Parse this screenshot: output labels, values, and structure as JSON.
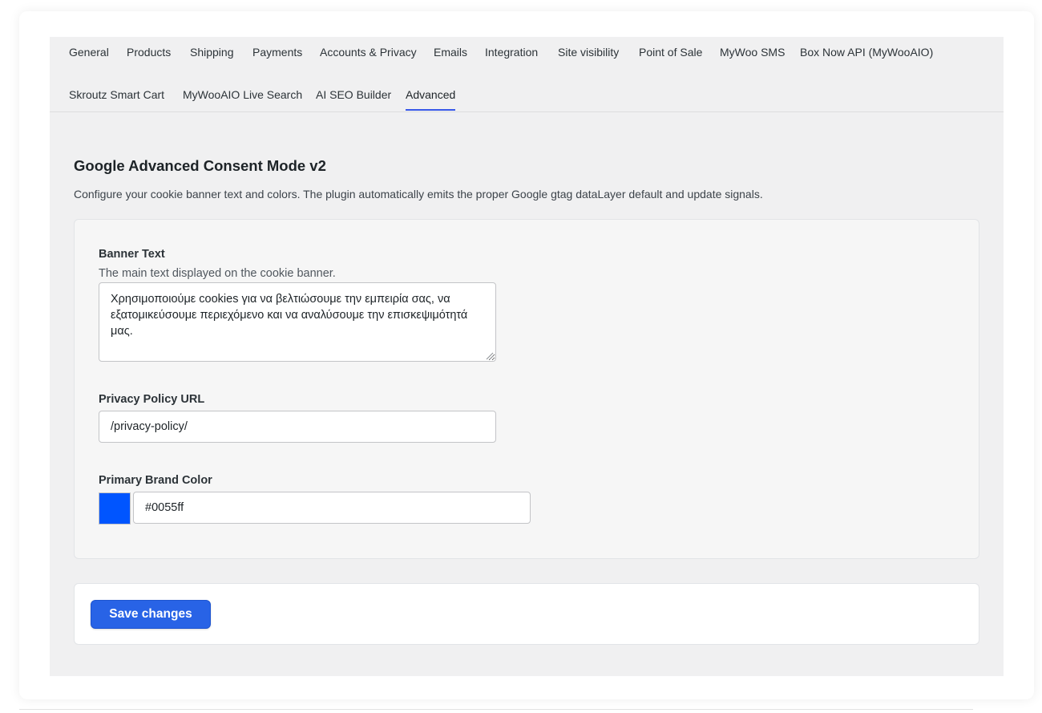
{
  "tabs": {
    "row1": [
      "General",
      "Products",
      "Shipping",
      "Payments",
      "Accounts & Privacy",
      "Emails",
      "Integration",
      "Site visibility",
      "Point of Sale",
      "MyWoo SMS",
      "Box Now API (MyWooAIO)"
    ],
    "row2": [
      "Skroutz Smart Cart",
      "MyWooAIO Live Search",
      "AI SEO Builder",
      "Advanced"
    ],
    "active": "Advanced"
  },
  "section": {
    "title": "Google Advanced Consent Mode v2",
    "description": "Configure your cookie banner text and colors. The plugin automatically emits the proper Google gtag dataLayer default and update signals."
  },
  "fields": {
    "banner_text": {
      "label": "Banner Text",
      "help": "The main text displayed on the cookie banner.",
      "value": "Χρησιμοποιούμε cookies για να βελτιώσουμε την εμπειρία σας, να εξατομικεύσουμε περιεχόμενο και να αναλύσουμε την επισκεψιμότητά μας."
    },
    "privacy_url": {
      "label": "Privacy Policy URL",
      "value": "/privacy-policy/"
    },
    "brand_color": {
      "label": "Primary Brand Color",
      "value": "#0055ff",
      "swatch_color": "#0055ff"
    }
  },
  "actions": {
    "save_label": "Save changes"
  },
  "colors": {
    "accent": "#2863e6",
    "tab_underline": "#3858e9"
  },
  "icons": {
    "resize": "resize-grip-icon"
  }
}
